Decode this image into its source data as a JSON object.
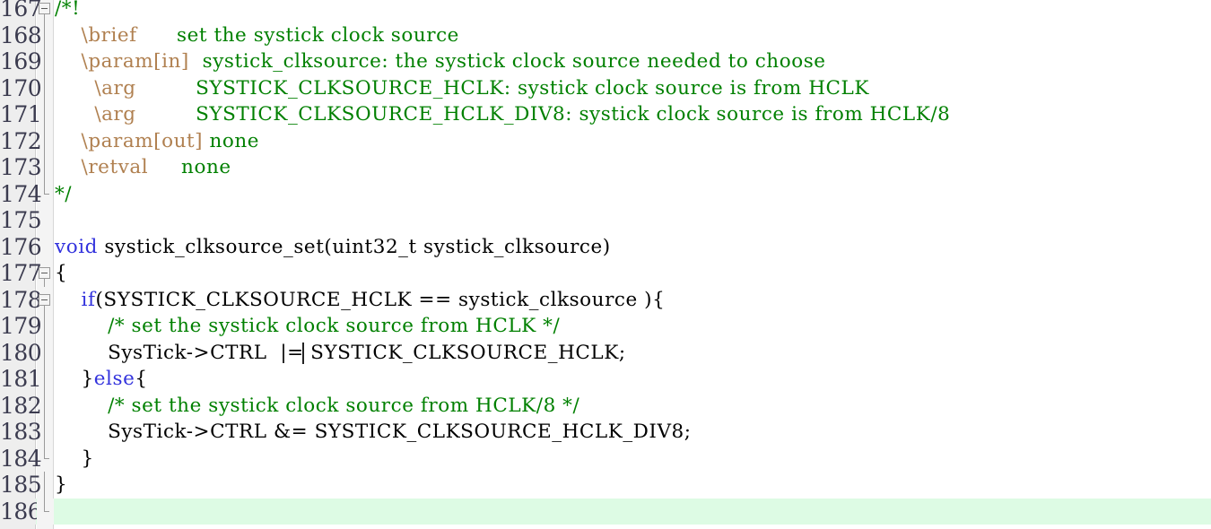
{
  "editor": {
    "name": "code-editor",
    "language": "c",
    "first_line": 167,
    "last_line": 186,
    "colors": {
      "background": "#ffffff",
      "gutter_background": "#eeeeee",
      "fold_margin_background": "#f4f4f4",
      "line_number": "#3b3b4f",
      "comment": "#008000",
      "doc_tag": "#b08050",
      "keyword": "#3333dd",
      "plain_text": "#000000",
      "modified_line_highlight": "#ddfbe4",
      "fold_marker": "#9a9a9a"
    },
    "caret": {
      "line": 180,
      "visible": true
    }
  },
  "lines": [
    {
      "number": "167",
      "fold": "box-open",
      "highlight": false,
      "tokens": [
        {
          "text": "/*!",
          "style": "comment"
        }
      ]
    },
    {
      "number": "168",
      "fold": "line",
      "highlight": false,
      "tokens": [
        {
          "text": "    ",
          "style": "plain"
        },
        {
          "text": "\\brief",
          "style": "doctag"
        },
        {
          "text": "      ",
          "style": "comment"
        },
        {
          "text": "set the systick clock source",
          "style": "comment"
        }
      ]
    },
    {
      "number": "169",
      "fold": "line",
      "highlight": false,
      "tokens": [
        {
          "text": "    ",
          "style": "plain"
        },
        {
          "text": "\\param[in]",
          "style": "doctag"
        },
        {
          "text": "  ",
          "style": "comment"
        },
        {
          "text": "systick_clksource: the systick clock source needed to choose",
          "style": "comment"
        }
      ]
    },
    {
      "number": "170",
      "fold": "line",
      "highlight": false,
      "tokens": [
        {
          "text": "      ",
          "style": "plain"
        },
        {
          "text": "\\arg",
          "style": "doctag"
        },
        {
          "text": "         ",
          "style": "comment"
        },
        {
          "text": "SYSTICK_CLKSOURCE_HCLK: systick clock source is from HCLK",
          "style": "comment"
        }
      ]
    },
    {
      "number": "171",
      "fold": "line",
      "highlight": false,
      "tokens": [
        {
          "text": "      ",
          "style": "plain"
        },
        {
          "text": "\\arg",
          "style": "doctag"
        },
        {
          "text": "         ",
          "style": "comment"
        },
        {
          "text": "SYSTICK_CLKSOURCE_HCLK_DIV8: systick clock source is from HCLK/8",
          "style": "comment"
        }
      ]
    },
    {
      "number": "172",
      "fold": "line",
      "highlight": false,
      "tokens": [
        {
          "text": "    ",
          "style": "plain"
        },
        {
          "text": "\\param[out]",
          "style": "doctag"
        },
        {
          "text": " ",
          "style": "comment"
        },
        {
          "text": "none",
          "style": "comment"
        }
      ]
    },
    {
      "number": "173",
      "fold": "line",
      "highlight": false,
      "tokens": [
        {
          "text": "    ",
          "style": "plain"
        },
        {
          "text": "\\retval",
          "style": "doctag"
        },
        {
          "text": "     ",
          "style": "comment"
        },
        {
          "text": "none",
          "style": "comment"
        }
      ]
    },
    {
      "number": "174",
      "fold": "line-end",
      "highlight": false,
      "tokens": [
        {
          "text": "*/",
          "style": "comment"
        }
      ]
    },
    {
      "number": "175",
      "fold": "none",
      "highlight": false,
      "tokens": []
    },
    {
      "number": "176",
      "fold": "none",
      "highlight": false,
      "tokens": [
        {
          "text": "void",
          "style": "keyword"
        },
        {
          "text": " systick_clksource_set(uint32_t systick_clksource)",
          "style": "plain"
        }
      ]
    },
    {
      "number": "177",
      "fold": "box-open",
      "highlight": false,
      "tokens": [
        {
          "text": "{",
          "style": "plain"
        }
      ]
    },
    {
      "number": "178",
      "fold": "box-open-nested",
      "highlight": false,
      "tokens": [
        {
          "text": "    ",
          "style": "plain"
        },
        {
          "text": "if",
          "style": "keyword"
        },
        {
          "text": "(SYSTICK_CLKSOURCE_HCLK == systick_clksource ){",
          "style": "plain"
        }
      ]
    },
    {
      "number": "179",
      "fold": "line",
      "highlight": false,
      "tokens": [
        {
          "text": "        ",
          "style": "plain"
        },
        {
          "text": "/* set the systick clock source from HCLK */",
          "style": "comment"
        }
      ]
    },
    {
      "number": "180",
      "fold": "line",
      "highlight": false,
      "tokens": [
        {
          "text": "        SysTick->CTRL  |= SYSTICK_CLKSOURCE_HCLK;",
          "style": "plain"
        }
      ]
    },
    {
      "number": "181",
      "fold": "line",
      "highlight": false,
      "tokens": [
        {
          "text": "    }",
          "style": "plain"
        },
        {
          "text": "else",
          "style": "keyword"
        },
        {
          "text": "{",
          "style": "plain"
        }
      ]
    },
    {
      "number": "182",
      "fold": "line",
      "highlight": false,
      "tokens": [
        {
          "text": "        ",
          "style": "plain"
        },
        {
          "text": "/* set the systick clock source from HCLK/8 */",
          "style": "comment"
        }
      ]
    },
    {
      "number": "183",
      "fold": "line",
      "highlight": false,
      "tokens": [
        {
          "text": "        SysTick->CTRL &= SYSTICK_CLKSOURCE_HCLK_DIV8;",
          "style": "plain"
        }
      ]
    },
    {
      "number": "184",
      "fold": "line-end-nested",
      "highlight": false,
      "tokens": [
        {
          "text": "    }",
          "style": "plain"
        }
      ]
    },
    {
      "number": "185",
      "fold": "line",
      "highlight": false,
      "tokens": [
        {
          "text": "}",
          "style": "plain"
        }
      ]
    },
    {
      "number": "186",
      "fold": "line-end",
      "highlight": true,
      "tokens": []
    }
  ]
}
